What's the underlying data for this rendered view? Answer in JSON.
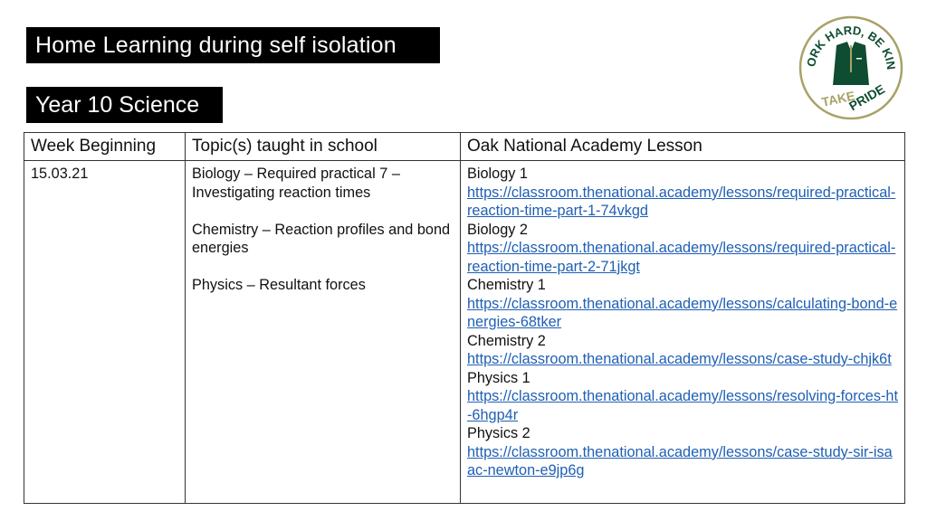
{
  "header": {
    "title": "Home Learning during self isolation",
    "subtitle": "Year 10 Science"
  },
  "logo": {
    "icon": "school-crest-blazer-icon",
    "top_text": "WORK HARD, BE KIND",
    "bottom_text_left": "TAKE",
    "bottom_text_right": "PRIDE",
    "colors": {
      "green": "#0f4d32",
      "gold": "#a9a268"
    }
  },
  "table": {
    "headers": [
      "Week Beginning",
      "Topic(s) taught in school",
      "Oak National Academy Lesson"
    ],
    "rows": [
      {
        "week": "15.03.21",
        "topics": [
          "Biology – Required practical 7 – Investigating reaction times",
          "Chemistry – Reaction profiles and bond energies",
          "Physics – Resultant forces"
        ],
        "lessons": [
          {
            "label": "Biology 1",
            "url": "https://classroom.thenational.academy/lessons/required-practical-reaction-time-part-1-74vkgd"
          },
          {
            "label": "Biology 2",
            "url": "https://classroom.thenational.academy/lessons/required-practical-reaction-time-part-2-71jkgt"
          },
          {
            "label": "Chemistry 1",
            "url": "https://classroom.thenational.academy/lessons/calculating-bond-energies-68tker"
          },
          {
            "label": "Chemistry 2",
            "url": "https://classroom.thenational.academy/lessons/case-study-chjk6t"
          },
          {
            "label": "Physics 1",
            "url": "https://classroom.thenational.academy/lessons/resolving-forces-ht-6hgp4r"
          },
          {
            "label": "Physics 2",
            "url": "https://classroom.thenational.academy/lessons/case-study-sir-isaac-newton-e9jp6g"
          }
        ]
      }
    ]
  },
  "colors": {
    "link": "#1f5fb4",
    "title_bg": "#000000",
    "title_fg": "#ffffff"
  }
}
